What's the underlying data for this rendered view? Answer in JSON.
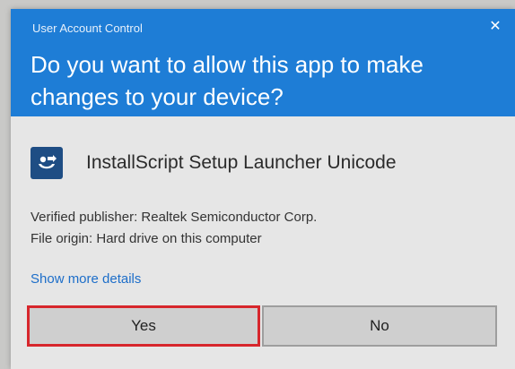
{
  "dialog": {
    "title": "User Account Control",
    "question": "Do you want to allow this app to make changes to your device?",
    "app_name": "InstallScript Setup Launcher Unicode",
    "publisher": "Verified publisher: Realtek Semiconductor Corp.",
    "origin": "File origin: Hard drive on this computer",
    "details_link": "Show more details",
    "yes_label": "Yes",
    "no_label": "No",
    "close_glyph": "✕"
  },
  "icons": {
    "close": "close-icon",
    "app": "installscript-app-icon"
  },
  "colors": {
    "header": "#1e7dd6",
    "link": "#1d6ec9",
    "highlight": "#d7262c",
    "body": "#e6e6e6"
  }
}
